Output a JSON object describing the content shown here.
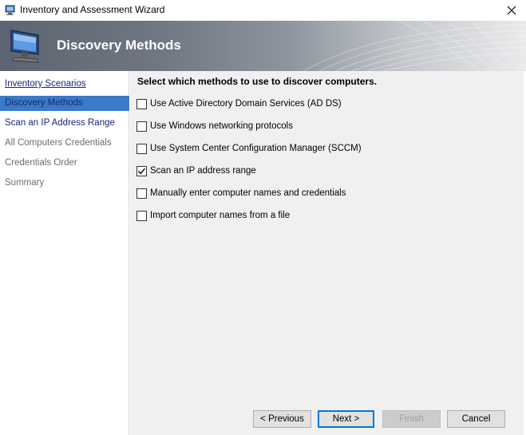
{
  "window": {
    "title": "Inventory and Assessment Wizard",
    "close_icon": "close-icon"
  },
  "banner": {
    "title": "Discovery Methods",
    "icon": "computer-monitor-icon"
  },
  "nav": {
    "items": [
      {
        "label": "Inventory Scenarios",
        "state": "link"
      },
      {
        "label": "Discovery Methods",
        "state": "selected"
      },
      {
        "label": "Scan an IP Address Range",
        "state": "active"
      },
      {
        "label": "All Computers Credentials",
        "state": "disabled"
      },
      {
        "label": "Credentials Order",
        "state": "disabled"
      },
      {
        "label": "Summary",
        "state": "disabled"
      }
    ]
  },
  "main": {
    "prompt": "Select which methods to use to discover computers.",
    "options": [
      {
        "label": "Use Active Directory Domain Services (AD DS)",
        "checked": false
      },
      {
        "label": "Use Windows networking protocols",
        "checked": false
      },
      {
        "label": "Use System Center Configuration Manager (SCCM)",
        "checked": false
      },
      {
        "label": "Scan an IP address range",
        "checked": true
      },
      {
        "label": "Manually enter computer names and credentials",
        "checked": false
      },
      {
        "label": "Import computer names from a file",
        "checked": false
      }
    ]
  },
  "buttons": {
    "previous": "< Previous",
    "next": "Next >",
    "finish": "Finish",
    "cancel": "Cancel"
  },
  "colors": {
    "selected_nav": "#3a7ac8",
    "default_button_border": "#0078d7",
    "content_bg": "#f0f0f0"
  }
}
